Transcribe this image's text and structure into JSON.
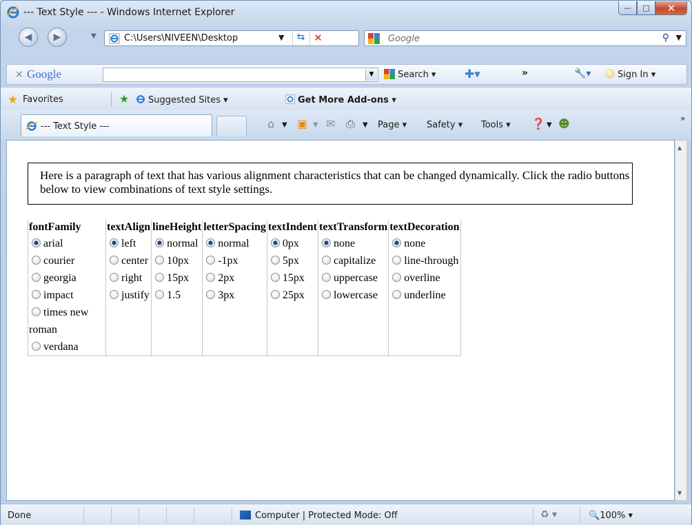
{
  "window": {
    "title": "--- Text Style --- - Windows Internet Explorer"
  },
  "address_bar": {
    "url": "C:\\Users\\NIVEEN\\Desktop"
  },
  "search_box": {
    "placeholder": "Google"
  },
  "google_toolbar": {
    "close": "×",
    "logo": "Google",
    "search_label": "Search ▾",
    "more": "»",
    "sign_in": "Sign In ▾"
  },
  "favorites_bar": {
    "favorites_label": "Favorites",
    "suggested_sites": "Suggested Sites ▾",
    "get_addons": "Get More Add-ons ▾"
  },
  "tab": {
    "label": "--- Text Style ---"
  },
  "command_bar": {
    "page": "Page ▾",
    "safety": "Safety ▾",
    "tools": "Tools ▾",
    "overflow": "»"
  },
  "content": {
    "paragraph": "Here is a paragraph of text that has various alignment characteristics that can be changed dynamically. Click the radio buttons below to view combinations of text style settings.",
    "columns": [
      {
        "header": "fontFamily",
        "options": [
          "arial",
          "courier",
          "georgia",
          "impact",
          "times new roman",
          "verdana"
        ],
        "selected": 0
      },
      {
        "header": "textAlign",
        "options": [
          "left",
          "center",
          "right",
          "justify"
        ],
        "selected": 0
      },
      {
        "header": "lineHeight",
        "options": [
          "normal",
          "10px",
          "15px",
          "1.5"
        ],
        "selected": 0
      },
      {
        "header": "letterSpacing",
        "options": [
          "normal",
          "-1px",
          "2px",
          "3px"
        ],
        "selected": 0
      },
      {
        "header": "textIndent",
        "options": [
          "0px",
          "5px",
          "15px",
          "25px"
        ],
        "selected": 0
      },
      {
        "header": "textTransform",
        "options": [
          "none",
          "capitalize",
          "uppercase",
          "lowercase"
        ],
        "selected": 0
      },
      {
        "header": "textDecoration",
        "options": [
          "none",
          "line-through",
          "overline",
          "underline"
        ],
        "selected": 0
      }
    ]
  },
  "status_bar": {
    "status": "Done",
    "zone": "Computer | Protected Mode: Off",
    "zoom": "100%"
  },
  "colors": {
    "chrome": "#c9d9ec",
    "close_button": "#c44a2d",
    "radio_dot": "#1b3f7a"
  },
  "icons": [
    "ie-logo-icon",
    "back-icon",
    "forward-icon",
    "refresh-icon",
    "stop-icon",
    "search-icon",
    "google-icon",
    "favorites-star-icon",
    "home-icon",
    "feeds-icon",
    "mail-icon",
    "print-icon",
    "help-icon",
    "computer-zone-icon",
    "zoom-icon"
  ]
}
